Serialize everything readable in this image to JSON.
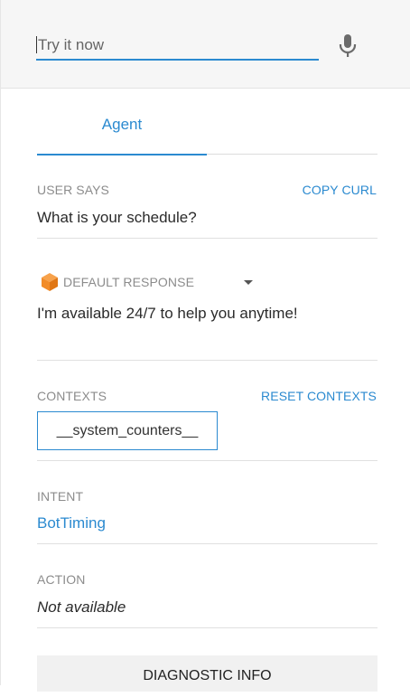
{
  "try_it": {
    "placeholder": "Try it now"
  },
  "icons": {
    "mic": "microphone-icon",
    "response": "orange-cube-icon",
    "dropdown": "caret-down-icon"
  },
  "tabs": [
    {
      "label": "Agent"
    }
  ],
  "user_says": {
    "label": "USER SAYS",
    "action": "COPY CURL",
    "value": "What is your schedule?"
  },
  "response": {
    "label": "DEFAULT RESPONSE",
    "value": "I'm available 24/7 to help you anytime!"
  },
  "contexts": {
    "label": "CONTEXTS",
    "action": "RESET CONTEXTS",
    "items": [
      "__system_counters__"
    ]
  },
  "intent": {
    "label": "INTENT",
    "value": "BotTiming"
  },
  "action": {
    "label": "ACTION",
    "value": "Not available"
  },
  "diagnostic": {
    "label": "DIAGNOSTIC INFO"
  },
  "colors": {
    "accent": "#2b8ad0",
    "cube": "#f28c28",
    "label_gray": "#8c8c8c"
  }
}
